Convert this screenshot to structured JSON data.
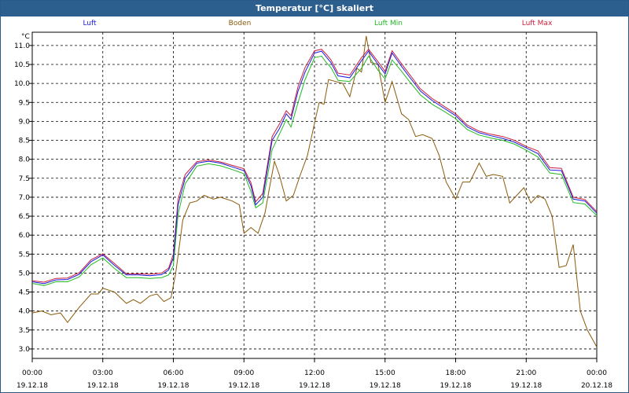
{
  "window": {
    "title": "Temperatur [°C] skaliert"
  },
  "chart_data": {
    "type": "line",
    "title": "Temperatur [°C] skaliert",
    "ylabel": "°C",
    "ylim": [
      2.75,
      11.35
    ],
    "yticks": [
      3.0,
      3.5,
      4.0,
      4.5,
      5.0,
      5.5,
      6.0,
      6.5,
      7.0,
      7.5,
      8.0,
      8.5,
      9.0,
      9.5,
      10.0,
      10.5,
      11.0
    ],
    "xlim_hours": [
      0,
      24
    ],
    "xticks": [
      {
        "hours": 0,
        "time": "00:00",
        "date": "19.12.18"
      },
      {
        "hours": 3,
        "time": "03:00",
        "date": "19.12.18"
      },
      {
        "hours": 6,
        "time": "06:00",
        "date": "19.12.18"
      },
      {
        "hours": 9,
        "time": "09:00",
        "date": "19.12.18"
      },
      {
        "hours": 12,
        "time": "12:00",
        "date": "19.12.18"
      },
      {
        "hours": 15,
        "time": "15:00",
        "date": "19.12.18"
      },
      {
        "hours": 18,
        "time": "18:00",
        "date": "19.12.18"
      },
      {
        "hours": 21,
        "time": "21:00",
        "date": "19.12.18"
      },
      {
        "hours": 24,
        "time": "00:00",
        "date": "20.12.18"
      }
    ],
    "grid": true,
    "legend_position": "top",
    "series": [
      {
        "name": "Luft",
        "color": "#1a1adc",
        "points": [
          [
            0.0,
            4.77
          ],
          [
            0.5,
            4.72
          ],
          [
            1.0,
            4.82
          ],
          [
            1.5,
            4.83
          ],
          [
            2.0,
            4.97
          ],
          [
            2.5,
            5.3
          ],
          [
            3.0,
            5.48
          ],
          [
            3.5,
            5.2
          ],
          [
            4.0,
            4.95
          ],
          [
            4.5,
            4.95
          ],
          [
            5.0,
            4.93
          ],
          [
            5.5,
            4.96
          ],
          [
            5.8,
            5.08
          ],
          [
            6.0,
            5.4
          ],
          [
            6.2,
            6.8
          ],
          [
            6.5,
            7.5
          ],
          [
            7.0,
            7.9
          ],
          [
            7.5,
            7.95
          ],
          [
            8.0,
            7.9
          ],
          [
            8.5,
            7.8
          ],
          [
            9.0,
            7.7
          ],
          [
            9.3,
            7.3
          ],
          [
            9.5,
            6.8
          ],
          [
            9.8,
            7.0
          ],
          [
            10.2,
            8.5
          ],
          [
            10.5,
            8.8
          ],
          [
            10.8,
            9.2
          ],
          [
            11.0,
            9.05
          ],
          [
            11.3,
            9.8
          ],
          [
            11.6,
            10.3
          ],
          [
            12.0,
            10.8
          ],
          [
            12.3,
            10.85
          ],
          [
            12.5,
            10.7
          ],
          [
            12.7,
            10.55
          ],
          [
            13.0,
            10.2
          ],
          [
            13.5,
            10.15
          ],
          [
            14.0,
            10.6
          ],
          [
            14.3,
            10.85
          ],
          [
            14.7,
            10.5
          ],
          [
            15.0,
            10.25
          ],
          [
            15.3,
            10.8
          ],
          [
            15.7,
            10.45
          ],
          [
            16.0,
            10.2
          ],
          [
            16.5,
            9.8
          ],
          [
            17.0,
            9.55
          ],
          [
            17.5,
            9.35
          ],
          [
            18.0,
            9.15
          ],
          [
            18.5,
            8.85
          ],
          [
            19.0,
            8.7
          ],
          [
            19.5,
            8.62
          ],
          [
            20.0,
            8.55
          ],
          [
            20.5,
            8.45
          ],
          [
            21.0,
            8.3
          ],
          [
            21.5,
            8.15
          ],
          [
            22.0,
            7.72
          ],
          [
            22.5,
            7.7
          ],
          [
            23.0,
            6.95
          ],
          [
            23.5,
            6.9
          ],
          [
            24.0,
            6.58
          ]
        ]
      },
      {
        "name": "Boden",
        "color": "#8b5a0a",
        "points": [
          [
            0.0,
            3.95
          ],
          [
            0.4,
            4.0
          ],
          [
            0.8,
            3.9
          ],
          [
            1.2,
            3.95
          ],
          [
            1.5,
            3.7
          ],
          [
            2.0,
            4.1
          ],
          [
            2.5,
            4.45
          ],
          [
            2.8,
            4.45
          ],
          [
            3.0,
            4.6
          ],
          [
            3.5,
            4.5
          ],
          [
            4.0,
            4.2
          ],
          [
            4.3,
            4.3
          ],
          [
            4.6,
            4.2
          ],
          [
            5.0,
            4.4
          ],
          [
            5.3,
            4.45
          ],
          [
            5.6,
            4.25
          ],
          [
            5.9,
            4.35
          ],
          [
            6.1,
            5.0
          ],
          [
            6.4,
            6.4
          ],
          [
            6.7,
            6.85
          ],
          [
            7.0,
            6.9
          ],
          [
            7.3,
            7.05
          ],
          [
            7.7,
            6.95
          ],
          [
            8.0,
            7.0
          ],
          [
            8.5,
            6.9
          ],
          [
            8.8,
            6.8
          ],
          [
            9.0,
            6.05
          ],
          [
            9.3,
            6.2
          ],
          [
            9.6,
            6.05
          ],
          [
            9.9,
            6.6
          ],
          [
            10.1,
            7.3
          ],
          [
            10.3,
            7.95
          ],
          [
            10.5,
            7.6
          ],
          [
            10.8,
            6.9
          ],
          [
            11.1,
            7.05
          ],
          [
            11.4,
            7.6
          ],
          [
            11.7,
            8.1
          ],
          [
            12.0,
            8.95
          ],
          [
            12.2,
            9.5
          ],
          [
            12.4,
            9.45
          ],
          [
            12.6,
            10.1
          ],
          [
            12.9,
            10.05
          ],
          [
            13.2,
            10.0
          ],
          [
            13.5,
            9.65
          ],
          [
            13.8,
            10.4
          ],
          [
            14.0,
            10.3
          ],
          [
            14.2,
            11.25
          ],
          [
            14.4,
            10.55
          ],
          [
            14.7,
            10.5
          ],
          [
            15.0,
            9.5
          ],
          [
            15.3,
            10.05
          ],
          [
            15.7,
            9.2
          ],
          [
            16.0,
            9.05
          ],
          [
            16.3,
            8.6
          ],
          [
            16.6,
            8.65
          ],
          [
            17.0,
            8.55
          ],
          [
            17.3,
            8.1
          ],
          [
            17.6,
            7.4
          ],
          [
            18.0,
            6.95
          ],
          [
            18.3,
            7.4
          ],
          [
            18.6,
            7.4
          ],
          [
            19.0,
            7.9
          ],
          [
            19.3,
            7.55
          ],
          [
            19.6,
            7.6
          ],
          [
            20.0,
            7.55
          ],
          [
            20.3,
            6.85
          ],
          [
            20.6,
            7.05
          ],
          [
            20.9,
            7.25
          ],
          [
            21.2,
            6.85
          ],
          [
            21.5,
            7.05
          ],
          [
            21.8,
            6.95
          ],
          [
            22.1,
            6.5
          ],
          [
            22.4,
            5.15
          ],
          [
            22.7,
            5.2
          ],
          [
            23.0,
            5.75
          ],
          [
            23.3,
            4.0
          ],
          [
            23.6,
            3.5
          ],
          [
            24.0,
            3.05
          ]
        ]
      },
      {
        "name": "Luft Min",
        "color": "#22bb22",
        "points": [
          [
            0.0,
            4.73
          ],
          [
            0.5,
            4.67
          ],
          [
            1.0,
            4.77
          ],
          [
            1.5,
            4.77
          ],
          [
            2.0,
            4.9
          ],
          [
            2.5,
            5.22
          ],
          [
            3.0,
            5.4
          ],
          [
            3.5,
            5.12
          ],
          [
            4.0,
            4.88
          ],
          [
            4.5,
            4.88
          ],
          [
            5.0,
            4.86
          ],
          [
            5.5,
            4.88
          ],
          [
            5.8,
            4.95
          ],
          [
            6.0,
            5.2
          ],
          [
            6.2,
            6.55
          ],
          [
            6.5,
            7.35
          ],
          [
            7.0,
            7.82
          ],
          [
            7.5,
            7.88
          ],
          [
            8.0,
            7.83
          ],
          [
            8.5,
            7.73
          ],
          [
            9.0,
            7.62
          ],
          [
            9.3,
            7.15
          ],
          [
            9.5,
            6.72
          ],
          [
            9.8,
            6.85
          ],
          [
            10.2,
            8.25
          ],
          [
            10.5,
            8.65
          ],
          [
            10.8,
            9.05
          ],
          [
            11.0,
            8.85
          ],
          [
            11.3,
            9.5
          ],
          [
            11.6,
            10.1
          ],
          [
            12.0,
            10.68
          ],
          [
            12.3,
            10.72
          ],
          [
            12.5,
            10.55
          ],
          [
            12.7,
            10.42
          ],
          [
            13.0,
            10.08
          ],
          [
            13.5,
            10.05
          ],
          [
            14.0,
            10.4
          ],
          [
            14.3,
            10.72
          ],
          [
            14.7,
            10.35
          ],
          [
            15.0,
            10.12
          ],
          [
            15.3,
            10.62
          ],
          [
            15.7,
            10.32
          ],
          [
            16.0,
            10.08
          ],
          [
            16.5,
            9.7
          ],
          [
            17.0,
            9.45
          ],
          [
            17.5,
            9.27
          ],
          [
            18.0,
            9.07
          ],
          [
            18.5,
            8.78
          ],
          [
            19.0,
            8.64
          ],
          [
            19.5,
            8.56
          ],
          [
            20.0,
            8.5
          ],
          [
            20.5,
            8.4
          ],
          [
            21.0,
            8.24
          ],
          [
            21.5,
            8.06
          ],
          [
            22.0,
            7.64
          ],
          [
            22.5,
            7.6
          ],
          [
            23.0,
            6.86
          ],
          [
            23.5,
            6.82
          ],
          [
            24.0,
            6.52
          ]
        ]
      },
      {
        "name": "Luft Max",
        "color": "#cc1f3c",
        "points": [
          [
            0.0,
            4.8
          ],
          [
            0.5,
            4.76
          ],
          [
            1.0,
            4.86
          ],
          [
            1.5,
            4.87
          ],
          [
            2.0,
            5.01
          ],
          [
            2.5,
            5.35
          ],
          [
            3.0,
            5.51
          ],
          [
            3.5,
            5.25
          ],
          [
            4.0,
            4.98
          ],
          [
            4.5,
            4.98
          ],
          [
            5.0,
            4.97
          ],
          [
            5.5,
            5.0
          ],
          [
            5.8,
            5.13
          ],
          [
            6.0,
            5.5
          ],
          [
            6.2,
            6.95
          ],
          [
            6.5,
            7.6
          ],
          [
            7.0,
            7.94
          ],
          [
            7.5,
            7.98
          ],
          [
            8.0,
            7.93
          ],
          [
            8.5,
            7.84
          ],
          [
            9.0,
            7.75
          ],
          [
            9.3,
            7.38
          ],
          [
            9.5,
            6.88
          ],
          [
            9.8,
            7.1
          ],
          [
            10.2,
            8.6
          ],
          [
            10.5,
            8.92
          ],
          [
            10.8,
            9.28
          ],
          [
            11.0,
            9.15
          ],
          [
            11.3,
            9.92
          ],
          [
            11.6,
            10.42
          ],
          [
            12.0,
            10.86
          ],
          [
            12.3,
            10.9
          ],
          [
            12.5,
            10.77
          ],
          [
            12.7,
            10.62
          ],
          [
            13.0,
            10.27
          ],
          [
            13.5,
            10.22
          ],
          [
            14.0,
            10.68
          ],
          [
            14.3,
            10.9
          ],
          [
            14.7,
            10.57
          ],
          [
            15.0,
            10.32
          ],
          [
            15.3,
            10.86
          ],
          [
            15.7,
            10.52
          ],
          [
            16.0,
            10.27
          ],
          [
            16.5,
            9.86
          ],
          [
            17.0,
            9.6
          ],
          [
            17.5,
            9.4
          ],
          [
            18.0,
            9.2
          ],
          [
            18.5,
            8.9
          ],
          [
            19.0,
            8.74
          ],
          [
            19.5,
            8.66
          ],
          [
            20.0,
            8.6
          ],
          [
            20.5,
            8.5
          ],
          [
            21.0,
            8.34
          ],
          [
            21.5,
            8.22
          ],
          [
            22.0,
            7.78
          ],
          [
            22.5,
            7.76
          ],
          [
            23.0,
            7.0
          ],
          [
            23.5,
            6.94
          ],
          [
            24.0,
            6.62
          ]
        ]
      }
    ]
  }
}
